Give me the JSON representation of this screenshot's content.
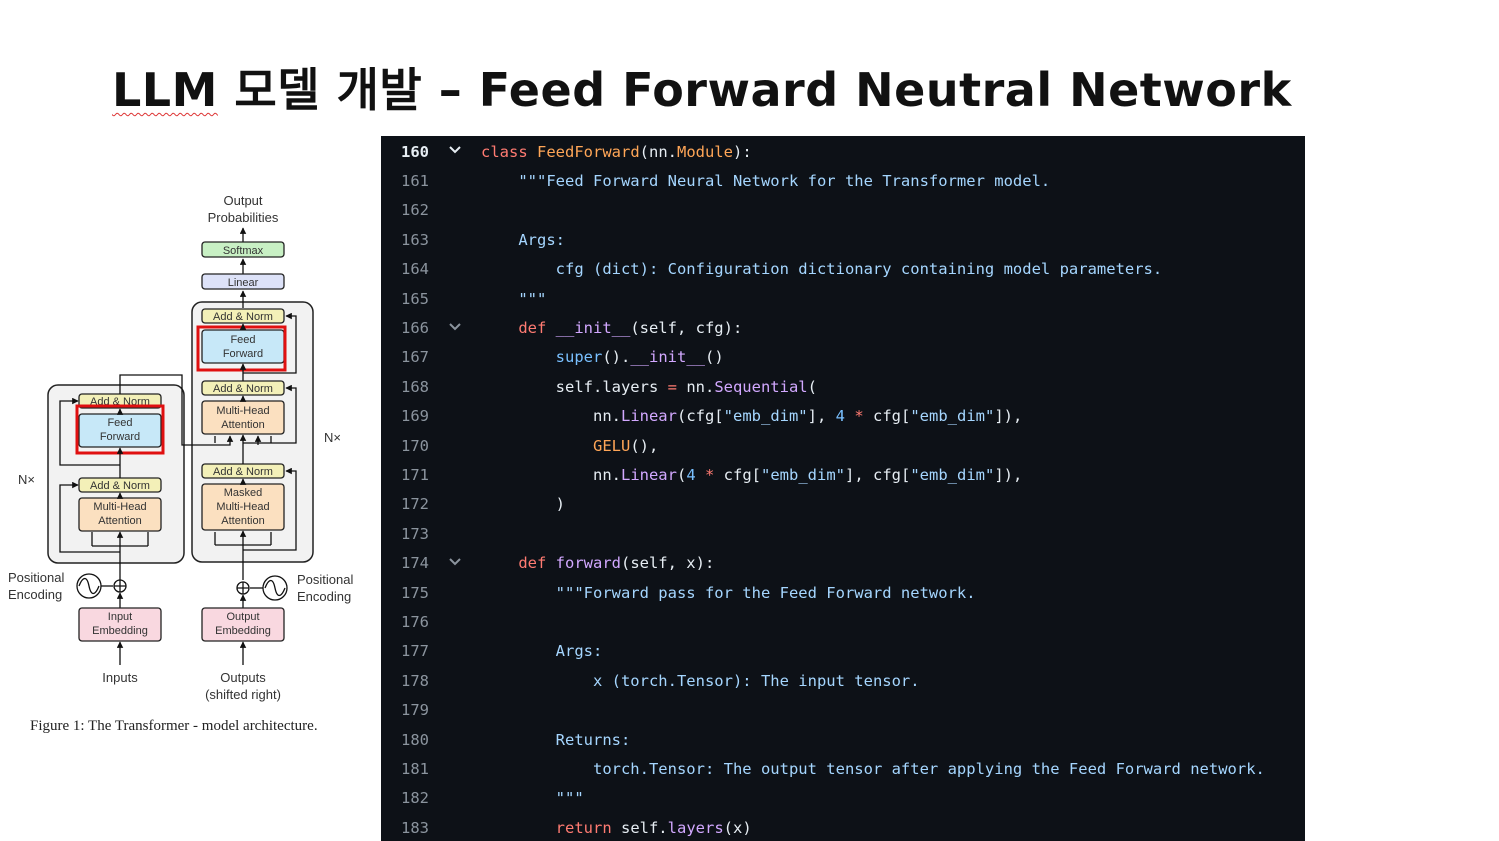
{
  "title": "LLM  모델 개발 –  Feed Forward Neutral Network",
  "title_parts": {
    "llm": "LLM",
    "rest": "  모델 개발 –  Feed Forward Neutral Network"
  },
  "diagram": {
    "output_probabilities": [
      "Output",
      "Probabilities"
    ],
    "softmax": "Softmax",
    "linear": "Linear",
    "add_norm": "Add & Norm",
    "feed_forward": [
      "Feed",
      "Forward"
    ],
    "multi_head_attention": [
      "Multi-Head",
      "Attention"
    ],
    "masked_multi_head_attention": [
      "Masked",
      "Multi-Head",
      "Attention"
    ],
    "nx": "N×",
    "positional_encoding": [
      "Positional",
      "Encoding"
    ],
    "input_embedding": [
      "Input",
      "Embedding"
    ],
    "output_embedding": [
      "Output",
      "Embedding"
    ],
    "inputs": "Inputs",
    "outputs": [
      "Outputs",
      "(shifted right)"
    ],
    "colors": {
      "feed_forward_fill": "#c7e8f8",
      "attention_fill": "#fbe0c0",
      "add_norm_fill": "#f3f0b8",
      "softmax_fill": "#c8f0c4",
      "linear_fill": "#dde2f8",
      "embedding_fill": "#f9d8e0",
      "highlight": "#e01010"
    }
  },
  "caption": "Figure 1: The Transformer - model architecture.",
  "editor": {
    "colors": {
      "background": "#0d1117",
      "keyword": "#ff7b72",
      "class_name": "#ffa657",
      "function": "#d2a8ff",
      "string": "#a5d6ff",
      "number": "#79c0ff"
    },
    "lines": [
      {
        "n": "160",
        "fold": true,
        "tokens": [
          [
            "kw",
            "class "
          ],
          [
            "cls",
            "FeedForward"
          ],
          [
            "pl",
            "(nn."
          ],
          [
            "cls",
            "Module"
          ],
          [
            "pl",
            "):"
          ]
        ]
      },
      {
        "n": "161",
        "fold": false,
        "tokens": [
          [
            "pl",
            "    "
          ],
          [
            "doc",
            "\"\"\"Feed Forward Neural Network for the Transformer model."
          ]
        ]
      },
      {
        "n": "162",
        "fold": false,
        "tokens": []
      },
      {
        "n": "163",
        "fold": false,
        "tokens": [
          [
            "pl",
            "    "
          ],
          [
            "doc",
            "Args:"
          ]
        ]
      },
      {
        "n": "164",
        "fold": false,
        "tokens": [
          [
            "pl",
            "        "
          ],
          [
            "doc",
            "cfg (dict): Configuration dictionary containing model parameters."
          ]
        ]
      },
      {
        "n": "165",
        "fold": false,
        "tokens": [
          [
            "pl",
            "    "
          ],
          [
            "doc",
            "\"\"\""
          ]
        ]
      },
      {
        "n": "166",
        "fold": true,
        "tokens": [
          [
            "pl",
            "    "
          ],
          [
            "kw",
            "def "
          ],
          [
            "fn",
            "__init__"
          ],
          [
            "pl",
            "(self, cfg):"
          ]
        ]
      },
      {
        "n": "167",
        "fold": false,
        "tokens": [
          [
            "pl",
            "        "
          ],
          [
            "bi",
            "super"
          ],
          [
            "pl",
            "()."
          ],
          [
            "fn",
            "__init__"
          ],
          [
            "pl",
            "()"
          ]
        ]
      },
      {
        "n": "168",
        "fold": false,
        "tokens": [
          [
            "pl",
            "        self.layers "
          ],
          [
            "op",
            "="
          ],
          [
            "pl",
            " nn."
          ],
          [
            "fn",
            "Sequential"
          ],
          [
            "pl",
            "("
          ]
        ]
      },
      {
        "n": "169",
        "fold": false,
        "tokens": [
          [
            "pl",
            "            nn."
          ],
          [
            "fn",
            "Linear"
          ],
          [
            "pl",
            "(cfg["
          ],
          [
            "str",
            "\"emb_dim\""
          ],
          [
            "pl",
            "], "
          ],
          [
            "num",
            "4"
          ],
          [
            "op",
            " * "
          ],
          [
            "pl",
            "cfg["
          ],
          [
            "str",
            "\"emb_dim\""
          ],
          [
            "pl",
            "]),"
          ]
        ]
      },
      {
        "n": "170",
        "fold": false,
        "tokens": [
          [
            "pl",
            "            "
          ],
          [
            "cls",
            "GELU"
          ],
          [
            "pl",
            "(),"
          ]
        ]
      },
      {
        "n": "171",
        "fold": false,
        "tokens": [
          [
            "pl",
            "            nn."
          ],
          [
            "fn",
            "Linear"
          ],
          [
            "pl",
            "("
          ],
          [
            "num",
            "4"
          ],
          [
            "op",
            " * "
          ],
          [
            "pl",
            "cfg["
          ],
          [
            "str",
            "\"emb_dim\""
          ],
          [
            "pl",
            "], cfg["
          ],
          [
            "str",
            "\"emb_dim\""
          ],
          [
            "pl",
            "]),"
          ]
        ]
      },
      {
        "n": "172",
        "fold": false,
        "tokens": [
          [
            "pl",
            "        )"
          ]
        ]
      },
      {
        "n": "173",
        "fold": false,
        "tokens": []
      },
      {
        "n": "174",
        "fold": true,
        "tokens": [
          [
            "pl",
            "    "
          ],
          [
            "kw",
            "def "
          ],
          [
            "fn",
            "forward"
          ],
          [
            "pl",
            "(self, x):"
          ]
        ]
      },
      {
        "n": "175",
        "fold": false,
        "tokens": [
          [
            "pl",
            "        "
          ],
          [
            "doc",
            "\"\"\"Forward pass for the Feed Forward network."
          ]
        ]
      },
      {
        "n": "176",
        "fold": false,
        "tokens": []
      },
      {
        "n": "177",
        "fold": false,
        "tokens": [
          [
            "pl",
            "        "
          ],
          [
            "doc",
            "Args:"
          ]
        ]
      },
      {
        "n": "178",
        "fold": false,
        "tokens": [
          [
            "pl",
            "            "
          ],
          [
            "doc",
            "x (torch.Tensor): The input tensor."
          ]
        ]
      },
      {
        "n": "179",
        "fold": false,
        "tokens": []
      },
      {
        "n": "180",
        "fold": false,
        "tokens": [
          [
            "pl",
            "        "
          ],
          [
            "doc",
            "Returns:"
          ]
        ]
      },
      {
        "n": "181",
        "fold": false,
        "tokens": [
          [
            "pl",
            "            "
          ],
          [
            "doc",
            "torch.Tensor: The output tensor after applying the Feed Forward network."
          ]
        ]
      },
      {
        "n": "182",
        "fold": false,
        "tokens": [
          [
            "pl",
            "        "
          ],
          [
            "doc",
            "\"\"\""
          ]
        ]
      },
      {
        "n": "183",
        "fold": false,
        "tokens": [
          [
            "pl",
            "        "
          ],
          [
            "kw",
            "return "
          ],
          [
            "pl",
            "self."
          ],
          [
            "fn",
            "layers"
          ],
          [
            "pl",
            "(x)"
          ]
        ]
      }
    ]
  }
}
